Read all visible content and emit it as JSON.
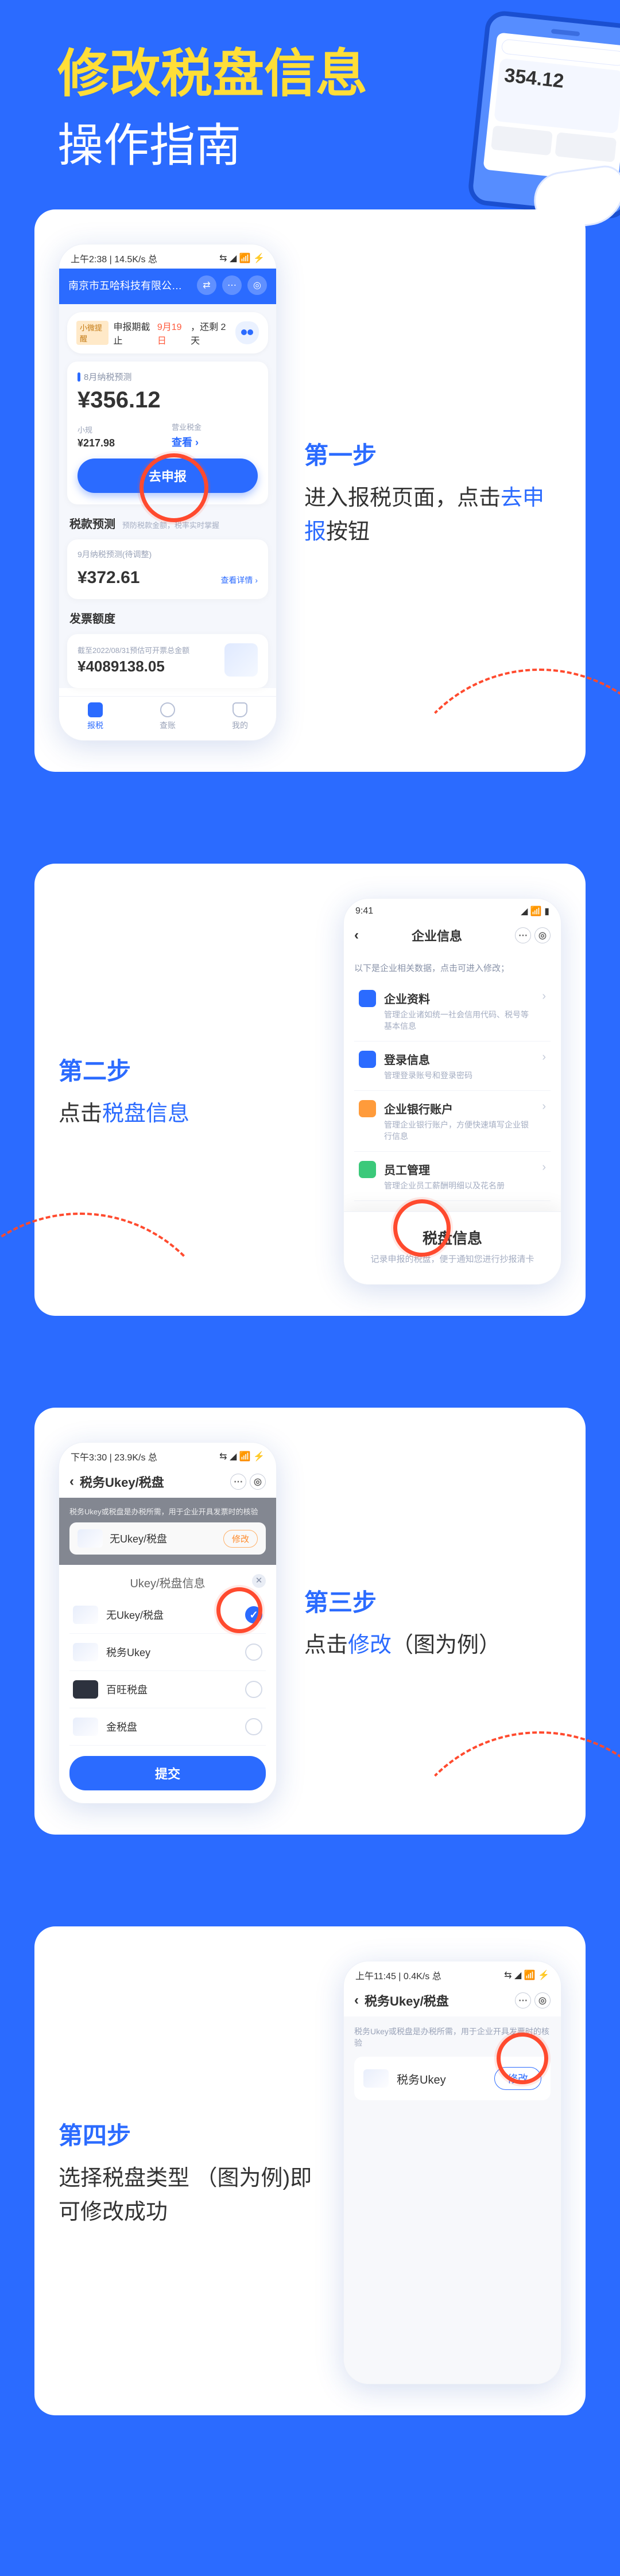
{
  "header": {
    "title": "修改税盘信息",
    "subtitle": "操作指南",
    "phone_big": "354.12"
  },
  "step1": {
    "label": "第一步",
    "body_pre": "进入报税页面，点击",
    "body_hl": "去申报",
    "body_post": "按钮",
    "phone": {
      "status_left": "上午2:38 | 14.5K/s 总",
      "status_right": "⇆ ◢ 📶 ⚡",
      "company": "南京市五哈科技有限公司…",
      "alert_tag": "小微提醒",
      "alert_a": "申报期截止",
      "alert_b": "9月19日",
      "alert_c": "，还剩 2 天",
      "card_lbl": "8月纳税预测",
      "amount": "¥356.12",
      "sub1_l": "小规",
      "sub1_v": "¥217.98",
      "sub2_l": "营业税金",
      "sub2_v": "查看 ›",
      "go": "去申报",
      "pred_h": "税款预测",
      "pred_sub": "预防税款金额，税率实时掌握",
      "pred_l": "9月纳税预测(待调整)",
      "pred_v": "¥372.61",
      "detail": "查看详情 ›",
      "inv_h": "发票额度",
      "inv_l": "截至2022/08/31预估可开票总金额",
      "inv_v": "¥4089138.05",
      "nav1": "报税",
      "nav2": "查账",
      "nav3": "我的"
    }
  },
  "step2": {
    "label": "第二步",
    "body_pre": "点击",
    "body_hl": "税盘信息",
    "phone": {
      "status_left": "9:41",
      "title": "企业信息",
      "hint": "以下是企业相关数据，点击可进入修改；",
      "i1_t": "企业资料",
      "i1_d": "管理企业诸如统一社会信用代码、税号等基本信息",
      "i2_t": "登录信息",
      "i2_d": "管理登录账号和登录密码",
      "i3_t": "企业银行账户",
      "i3_d": "管理企业银行账户，方便快速填写企业银行信息",
      "i4_t": "员工管理",
      "i4_d": "管理企业员工薪酬明细以及花名册",
      "pop_t": "税盘信息",
      "pop_d": "记录申报的税盘，便于通知您进行抄报清卡"
    }
  },
  "step3": {
    "label": "第三步",
    "body_pre": "点击",
    "body_hl": "修改",
    "body_post": "（图为例）",
    "phone": {
      "status_left": "下午3:30 | 23.9K/s 总",
      "title": "税务Ukey/税盘",
      "hint": "税务Ukey或税盘是办税所需，用于企业开具发票时的核验",
      "chip_name": "无Ukey/税盘",
      "chip_btn": "修改",
      "sheet_title": "Ukey/税盘信息",
      "o1": "无Ukey/税盘",
      "o2": "税务Ukey",
      "o3": "百旺税盘",
      "o4": "金税盘",
      "submit": "提交"
    }
  },
  "step4": {
    "label": "第四步",
    "body": "选择税盘类型  （图为例)即可修改成功",
    "phone": {
      "status_left": "上午11:45 | 0.4K/s 总",
      "title": "税务Ukey/税盘",
      "hint": "税务Ukey或税盘是办税所需，用于企业开具发票时的核验",
      "name": "税务Ukey",
      "btn": "修改"
    }
  }
}
